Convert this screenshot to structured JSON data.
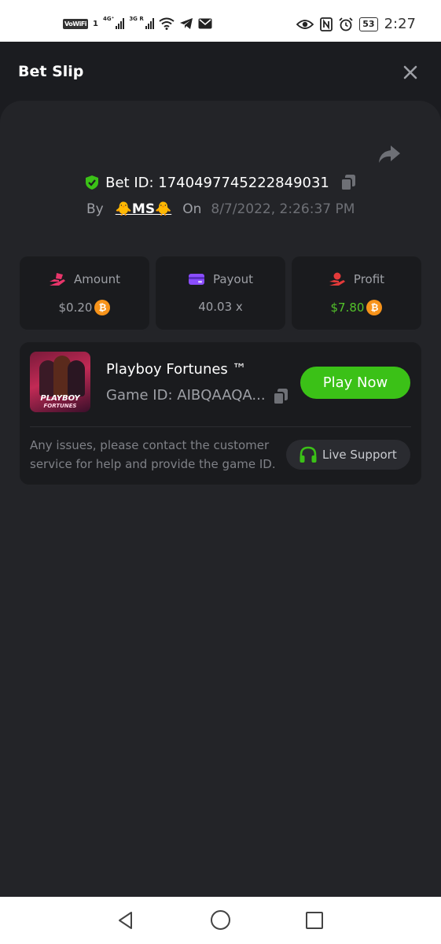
{
  "status_bar": {
    "vowifi": "VoWiFi",
    "sim": "1",
    "net1": "4G⁺",
    "net2": "3G R",
    "battery": "53",
    "time": "2:27"
  },
  "header": {
    "title": "Bet Slip"
  },
  "bet": {
    "id_text": "Bet ID: 1740497745222849031",
    "by_label": "By",
    "user": "🐥MS🐥",
    "on_label": "On",
    "date": "8/7/2022, 2:26:37 PM"
  },
  "stats": [
    {
      "label": "Amount",
      "value": "$0.20",
      "coin": "bitcoin",
      "icon": "hand-coin-icon",
      "accent": "#e8356a"
    },
    {
      "label": "Payout",
      "value": "40.03 x",
      "icon": "wallet-card-icon",
      "accent": "#8a4dff"
    },
    {
      "label": "Profit",
      "value": "$7.80",
      "coin": "bitcoin",
      "icon": "hand-profit-icon",
      "accent": "#e53a3a",
      "value_color": "#53c22a"
    }
  ],
  "game": {
    "name": "Playboy Fortunes ™",
    "id_text": "Game ID: AIBQAAQA...",
    "thumb_title": "PLAYBOY",
    "thumb_sub": "FORTUNES",
    "play_label": "Play Now",
    "notice": "Any issues, please contact the customer service for help and provide the game ID.",
    "support_label": "Live Support"
  },
  "colors": {
    "accent_green": "#3bc117",
    "bitcoin": "#f7931a",
    "background": "#1b1c20",
    "panel": "#232428",
    "card": "#1a1b1e"
  }
}
